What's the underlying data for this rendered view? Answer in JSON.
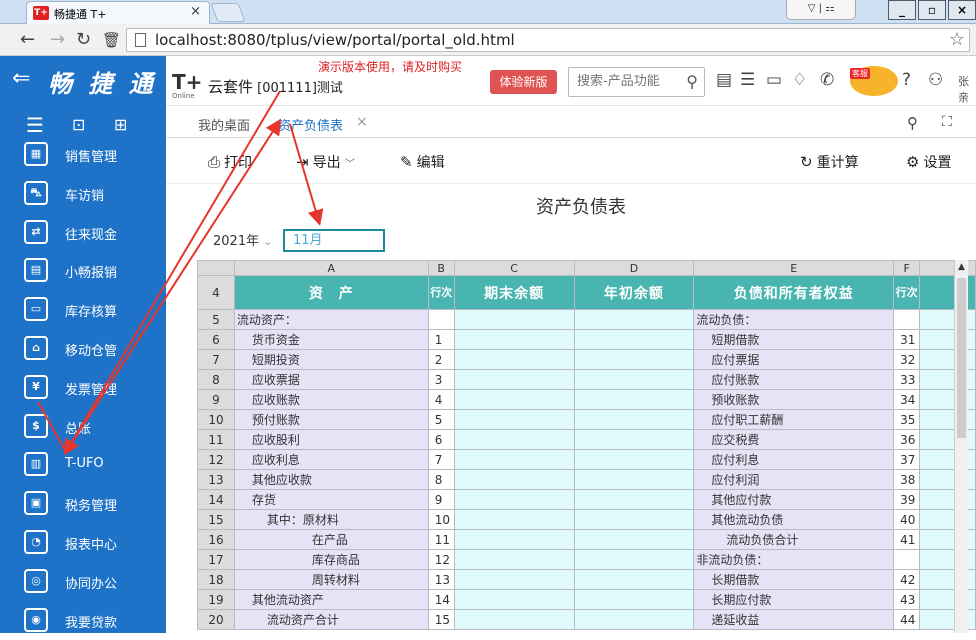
{
  "browser": {
    "tab_title": "畅捷通 T+",
    "tab_icon": "T+",
    "url": "localhost:8080/tplus/view/portal/portal_old.html",
    "window_buttons": [
      "_",
      "▫",
      "×"
    ]
  },
  "header": {
    "brand": "畅 捷 通",
    "suite_logo": "T+",
    "suite_logo_sub": "Online",
    "suite_name": "云套件",
    "account": "[001111]测试",
    "notice": "演示版本使用，请及时购买",
    "try_new_label": "体验新版",
    "search_placeholder": "搜索-产品功能",
    "mascot_badge": "客服",
    "username": "张亲"
  },
  "sidebar": {
    "items": [
      {
        "label": "销售管理",
        "icon": "sales-chart-icon",
        "glyph": "▦"
      },
      {
        "label": "车访销",
        "icon": "car-icon",
        "glyph": "⛍"
      },
      {
        "label": "往来现金",
        "icon": "transfer-icon",
        "glyph": "⇄"
      },
      {
        "label": "小畅报销",
        "icon": "reimburse-icon",
        "glyph": "▤"
      },
      {
        "label": "库存核算",
        "icon": "inventory-icon",
        "glyph": "▭"
      },
      {
        "label": "移动仓管",
        "icon": "warehouse-icon",
        "glyph": "⌂"
      },
      {
        "label": "发票管理",
        "icon": "invoice-icon",
        "glyph": "¥"
      },
      {
        "label": "总账",
        "icon": "ledger-icon",
        "glyph": "$"
      },
      {
        "label": "T-UFO",
        "icon": "tufo-icon",
        "glyph": "▥"
      },
      {
        "label": "税务管理",
        "icon": "tax-icon",
        "glyph": "▣"
      },
      {
        "label": "报表中心",
        "icon": "report-center-icon",
        "glyph": "◔"
      },
      {
        "label": "协同办公",
        "icon": "collab-icon",
        "glyph": "◎"
      },
      {
        "label": "我要贷款",
        "icon": "loan-icon",
        "glyph": "◉"
      }
    ]
  },
  "tabs": {
    "home": "我的桌面",
    "active": "资产负债表"
  },
  "toolbar": {
    "print": "打印",
    "export": "导出",
    "edit": "编辑",
    "recalc": "重计算",
    "settings": "设置"
  },
  "report": {
    "title": "资产负债表",
    "year": "2021年",
    "month": "11月",
    "col_letters": [
      "A",
      "B",
      "C",
      "D",
      "E",
      "F"
    ],
    "headers": [
      "资　产",
      "行次",
      "期末余额",
      "年初余额",
      "负债和所有者权益",
      "行次"
    ],
    "rows": [
      {
        "n": "5",
        "a": "流动资产：",
        "b": "",
        "e": "流动负债：",
        "f": "",
        "ai": 0,
        "ei": 0
      },
      {
        "n": "6",
        "a": "货币资金",
        "b": "1",
        "e": "短期借款",
        "f": "31",
        "ai": 1,
        "ei": 1
      },
      {
        "n": "7",
        "a": "短期投资",
        "b": "2",
        "e": "应付票据",
        "f": "32",
        "ai": 1,
        "ei": 1
      },
      {
        "n": "8",
        "a": "应收票据",
        "b": "3",
        "e": "应付账款",
        "f": "33",
        "ai": 1,
        "ei": 1
      },
      {
        "n": "9",
        "a": "应收账款",
        "b": "4",
        "e": "预收账款",
        "f": "34",
        "ai": 1,
        "ei": 1
      },
      {
        "n": "10",
        "a": "预付账款",
        "b": "5",
        "e": "应付职工薪酬",
        "f": "35",
        "ai": 1,
        "ei": 1
      },
      {
        "n": "11",
        "a": "应收股利",
        "b": "6",
        "e": "应交税费",
        "f": "36",
        "ai": 1,
        "ei": 1
      },
      {
        "n": "12",
        "a": "应收利息",
        "b": "7",
        "e": "应付利息",
        "f": "37",
        "ai": 1,
        "ei": 1
      },
      {
        "n": "13",
        "a": "其他应收款",
        "b": "8",
        "e": "应付利润",
        "f": "38",
        "ai": 1,
        "ei": 1
      },
      {
        "n": "14",
        "a": "存货",
        "b": "9",
        "e": "其他应付款",
        "f": "39",
        "ai": 1,
        "ei": 1
      },
      {
        "n": "15",
        "a": "其中：原材料",
        "b": "10",
        "e": "其他流动负债",
        "f": "40",
        "ai": 2,
        "ei": 1
      },
      {
        "n": "16",
        "a": "在产品",
        "b": "11",
        "e": "流动负债合计",
        "f": "41",
        "ai": 5,
        "ei": 2
      },
      {
        "n": "17",
        "a": "库存商品",
        "b": "12",
        "e": "非流动负债：",
        "f": "",
        "ai": 5,
        "ei": 0
      },
      {
        "n": "18",
        "a": "周转材料",
        "b": "13",
        "e": "长期借款",
        "f": "42",
        "ai": 5,
        "ei": 1
      },
      {
        "n": "19",
        "a": "其他流动资产",
        "b": "14",
        "e": "长期应付款",
        "f": "43",
        "ai": 1,
        "ei": 1
      },
      {
        "n": "20",
        "a": "流动资产合计",
        "b": "15",
        "e": "递延收益",
        "f": "44",
        "ai": 2,
        "ei": 1
      }
    ]
  },
  "colors": {
    "brand_blue": "#1e73c9",
    "header_teal": "#48b5b0",
    "annotation_red": "#e8352b"
  }
}
